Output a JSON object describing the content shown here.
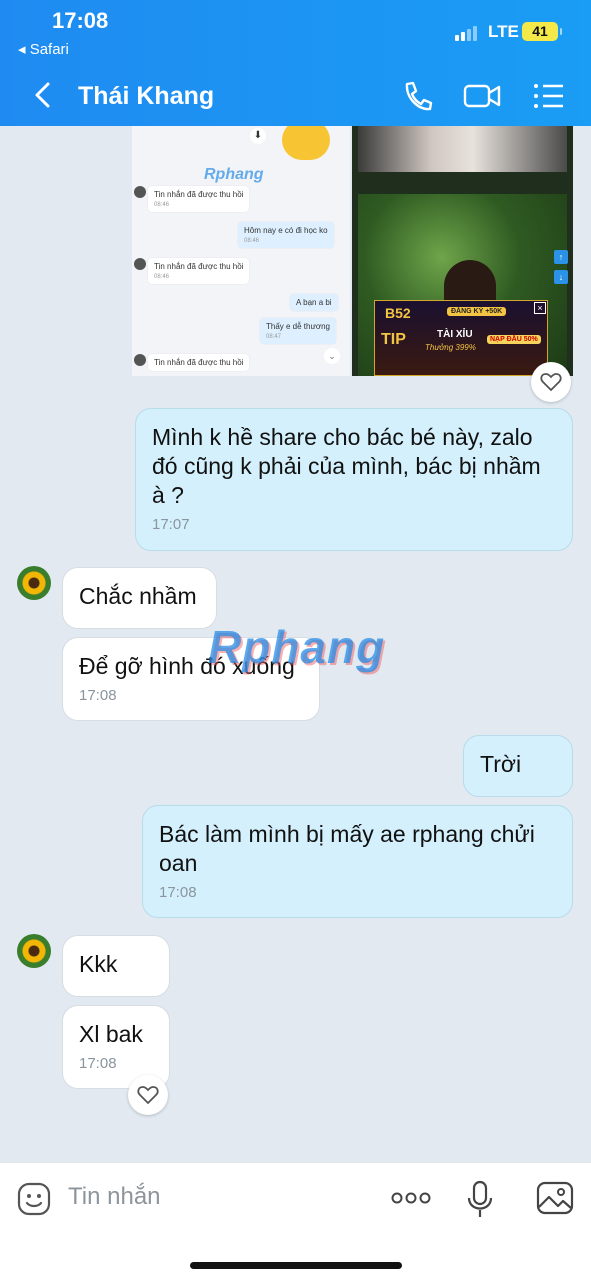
{
  "status_bar": {
    "time": "17:08",
    "back_app": "◂ Safari",
    "network": "LTE",
    "battery": "41"
  },
  "header": {
    "contact_name": "Thái Khang"
  },
  "shared_image": {
    "watermark": "Rphang",
    "inner_messages": [
      {
        "text": "Tin nhắn đã được thu hồi",
        "time": "08:46"
      },
      {
        "text": "Hôm nay e có đi học ko",
        "time": "08:46"
      },
      {
        "text": "Tin nhắn đã được thu hồi",
        "time": "08:46"
      },
      {
        "text": "A bạn a bi",
        "time": ""
      },
      {
        "text": "Thấy e dễ thương",
        "time": "08:47"
      },
      {
        "text": "Tin nhắn đã được thu hồi",
        "time": ""
      }
    ],
    "ad_texts": [
      "B52",
      "ĐĂNG KÝ +50K",
      "TIP",
      "TÀI XỈU",
      "Thưởng 399%",
      "NẠP ĐẦU 50%"
    ]
  },
  "messages": [
    {
      "text": "Mình k hề share cho bác bé này, zalo đó cũng k phải của mình, bác bị nhầm à ?",
      "time": "17:07"
    },
    {
      "text": "Chắc nhầm"
    },
    {
      "text": "Để gỡ hình đó xuống",
      "time": "17:08"
    },
    {
      "text": "Trời"
    },
    {
      "text": "Bác làm mình bị mấy ae rphang chửi oan",
      "time": "17:08"
    },
    {
      "text": "Kkk"
    },
    {
      "text": "Xl bak",
      "time": "17:08"
    }
  ],
  "watermark": "Rphang",
  "composer": {
    "placeholder": "Tin nhắn"
  },
  "colors": {
    "header": "#1a9df4",
    "outgoing": "#d4f0fc",
    "incoming": "#ffffff",
    "background": "#e2e9f1"
  }
}
